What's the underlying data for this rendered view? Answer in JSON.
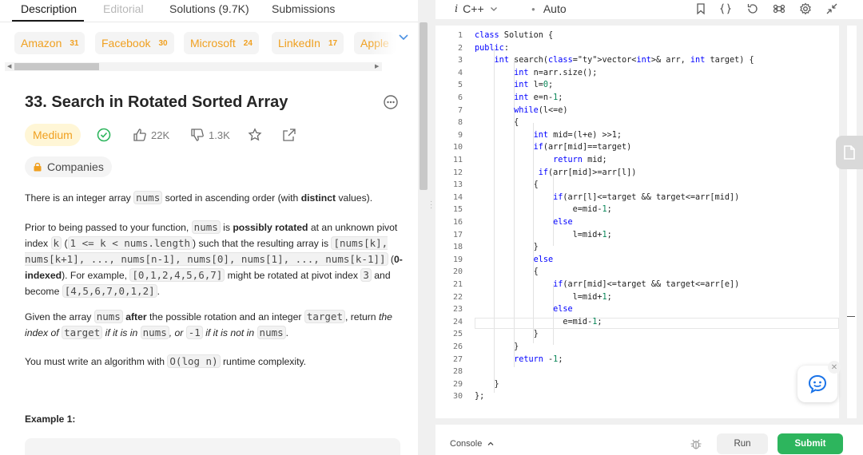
{
  "tabs": [
    {
      "label": "Description",
      "state": "active"
    },
    {
      "label": "Editorial",
      "state": "disabled"
    },
    {
      "label": "Solutions (9.7K)",
      "state": "normal"
    },
    {
      "label": "Submissions",
      "state": "normal"
    }
  ],
  "company_tags": [
    {
      "name": "Amazon",
      "count": "31"
    },
    {
      "name": "Facebook",
      "count": "30"
    },
    {
      "name": "Microsoft",
      "count": "24"
    },
    {
      "name": "LinkedIn",
      "count": "17"
    },
    {
      "name": "Apple",
      "count": ""
    }
  ],
  "problem": {
    "title": "33. Search in Rotated Sorted Array",
    "difficulty": "Medium",
    "likes": "22K",
    "dislikes": "1.3K",
    "companies_label": "Companies"
  },
  "description": {
    "p1": {
      "t1": "There is an integer array ",
      "c1": "nums",
      "t2": " sorted in ascending order (with ",
      "b1": "distinct",
      "t3": " values)."
    },
    "p2": {
      "t1": "Prior to being passed to your function, ",
      "c1": "nums",
      "t2": " is ",
      "b1": "possibly rotated",
      "t3": " at an unknown pivot index ",
      "c2": "k",
      "t4": " (",
      "c3": "1 <= k < nums.length",
      "t5": ") such that the resulting array is ",
      "c4": "[nums[k], nums[k+1], ..., nums[n-1], nums[0], nums[1], ..., nums[k-1]]",
      "t6": " (",
      "b2": "0-indexed",
      "t7": "). For example, ",
      "c5": "[0,1,2,4,5,6,7]",
      "t8": " might be rotated at pivot index ",
      "c6": "3",
      "t9": " and become ",
      "c7": "[4,5,6,7,0,1,2]",
      "t10": "."
    },
    "p3": {
      "t1": "Given the array ",
      "c1": "nums",
      "t2": " ",
      "b1": "after",
      "t3": " the possible rotation and an integer ",
      "c2": "target",
      "t4": ", return ",
      "i1": "the index of ",
      "c3": "target",
      "i2": " if it is in ",
      "c4": "nums",
      "i3": ", or ",
      "c5": "-1",
      "i4": " if it is not in ",
      "c6": "nums",
      "t5": "."
    },
    "p4": {
      "t1": "You must write an algorithm with ",
      "c1": "O(log n)",
      "t2": " runtime complexity."
    },
    "example_heading": "Example 1:"
  },
  "editor": {
    "language": "C++",
    "mode": "Auto",
    "lines": [
      "class Solution {",
      "public:",
      "    int search(vector<int>& arr, int target) {",
      "        int n=arr.size();",
      "        int l=0;",
      "        int e=n-1;",
      "        while(l<=e)",
      "        {",
      "            int mid=(l+e) >>1;",
      "            if(arr[mid]==target)",
      "                return mid;",
      "             if(arr[mid]>=arr[l])",
      "            {",
      "                if(arr[l]<=target && target<=arr[mid])",
      "                    e=mid-1;",
      "                else",
      "                    l=mid+1;",
      "            }",
      "            else",
      "            {",
      "                if(arr[mid]<=target && target<=arr[e])",
      "                    l=mid+1;",
      "                else",
      "                  e=mid-1;",
      "            }",
      "        }",
      "        return -1;",
      "",
      "    }",
      "};"
    ],
    "line_numbers": [
      "1",
      "2",
      "3",
      "4",
      "5",
      "6",
      "7",
      "8",
      "9",
      "10",
      "11",
      "12",
      "13",
      "14",
      "15",
      "16",
      "17",
      "18",
      "19",
      "20",
      "21",
      "22",
      "23",
      "24",
      "25",
      "26",
      "27",
      "28",
      "29",
      "30"
    ]
  },
  "footer": {
    "console_label": "Console",
    "run_label": "Run",
    "submit_label": "Submit"
  },
  "colors": {
    "accent_green": "#2db55d",
    "difficulty_medium": "#f0a020",
    "keyword_blue": "#0000ff",
    "type_teal": "#267f99",
    "number_green": "#098658"
  }
}
